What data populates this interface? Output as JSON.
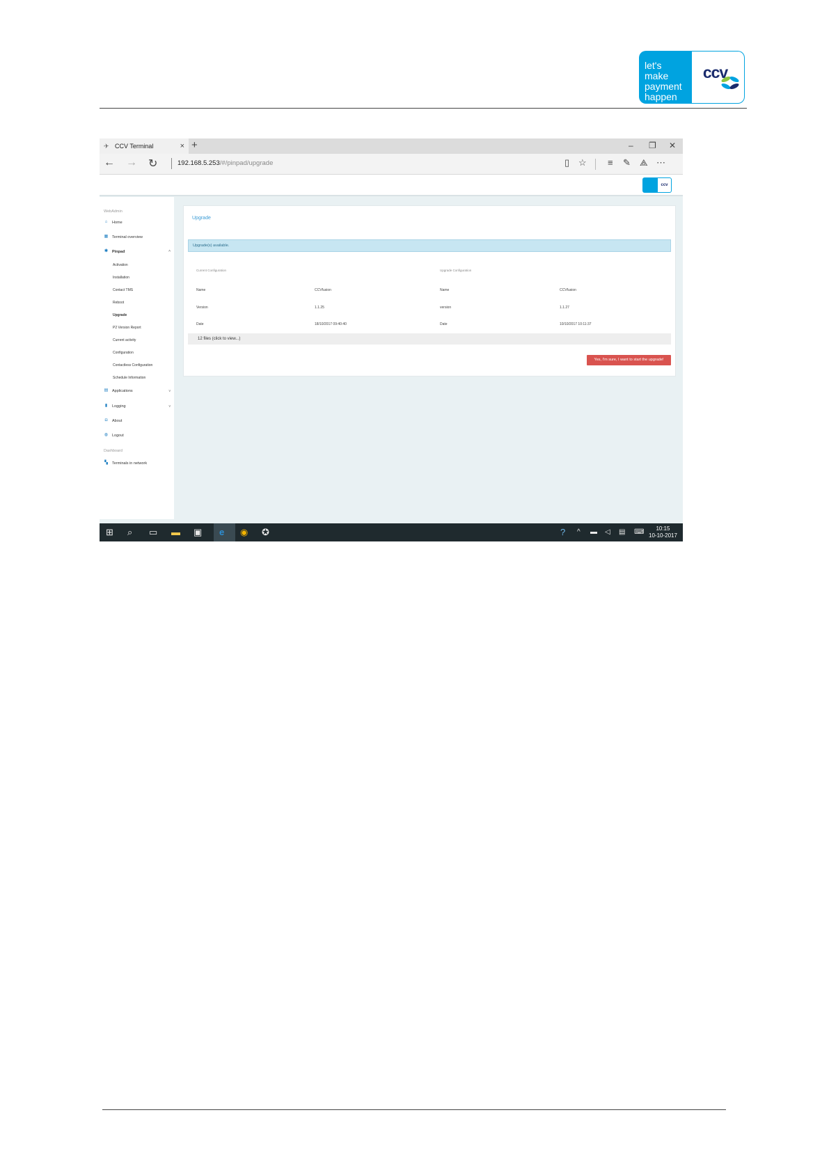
{
  "doc": {
    "logo_text": "let's make payment happen",
    "logo_line1": "let's make",
    "logo_line2": "payment",
    "logo_line3": "happen",
    "logo_brand": "ccv"
  },
  "browser": {
    "tab_title": "CCV Terminal",
    "tab_close": "×",
    "new_tab": "+",
    "minimize": "–",
    "restore": "❐",
    "close": "✕",
    "back": "←",
    "forward": "→",
    "refresh": "↻",
    "url_host": "192.168.5.253",
    "url_path": "/#/pinpad/upgrade"
  },
  "sidebar": {
    "section_webadmin": "WebAdmin",
    "items": [
      {
        "label": "Home",
        "icon": "home-icon",
        "glyph": "⌂"
      },
      {
        "label": "Terminal overview",
        "icon": "calendar-icon",
        "glyph": "▦"
      },
      {
        "label": "Pinpad",
        "icon": "pinpad-icon",
        "glyph": "✱",
        "caret": "^"
      }
    ],
    "pinpad_subitems": [
      "Activation",
      "Installation",
      "Contact TMS",
      "Reboot",
      "Upgrade",
      "P2 Version Report",
      "Current activity",
      "Configuration",
      "Contactless Configuration",
      "Schedule Information"
    ],
    "lower_items": [
      {
        "label": "Applications",
        "icon": "printer-icon",
        "glyph": "▤",
        "caret": "v"
      },
      {
        "label": "Logging",
        "icon": "file-icon",
        "glyph": "▮",
        "caret": "v"
      },
      {
        "label": "About",
        "icon": "chat-icon",
        "glyph": "◘"
      },
      {
        "label": "Logout",
        "icon": "lock-icon",
        "glyph": "◍"
      }
    ],
    "section_dashboard": "Dashboard",
    "dashboard_item": {
      "label": "Terminals in network",
      "icon": "grid-icon",
      "glyph": "▚"
    }
  },
  "main": {
    "title": "Upgrade",
    "alert": "Upgrade(s) available.",
    "current_header": "Current Configuration",
    "upgrade_header": "Upgrade Configuration",
    "rows": [
      {
        "label": "Name",
        "current": "CCVfusion",
        "label2": "Name",
        "upgrade": "CCVfusion"
      },
      {
        "label": "Version",
        "current": "1.1.25",
        "label2": "version",
        "upgrade": "1.1.27"
      },
      {
        "label": "Date",
        "current": "18/10/2017 09:40:40",
        "label2": "Date",
        "upgrade": "10/10/2017 10:11:37"
      }
    ],
    "files_label": "12 files (click to view...)",
    "upgrade_button": "Yes, I'm sure, I want to start the upgrade!"
  },
  "taskbar": {
    "time": "10:15",
    "date": "10-10-2017"
  },
  "colors": {
    "ccv_blue": "#00a3e0",
    "ccv_navy": "#1a2b6d",
    "alert_bg": "#c7e6f2",
    "button_red": "#d9534f"
  }
}
